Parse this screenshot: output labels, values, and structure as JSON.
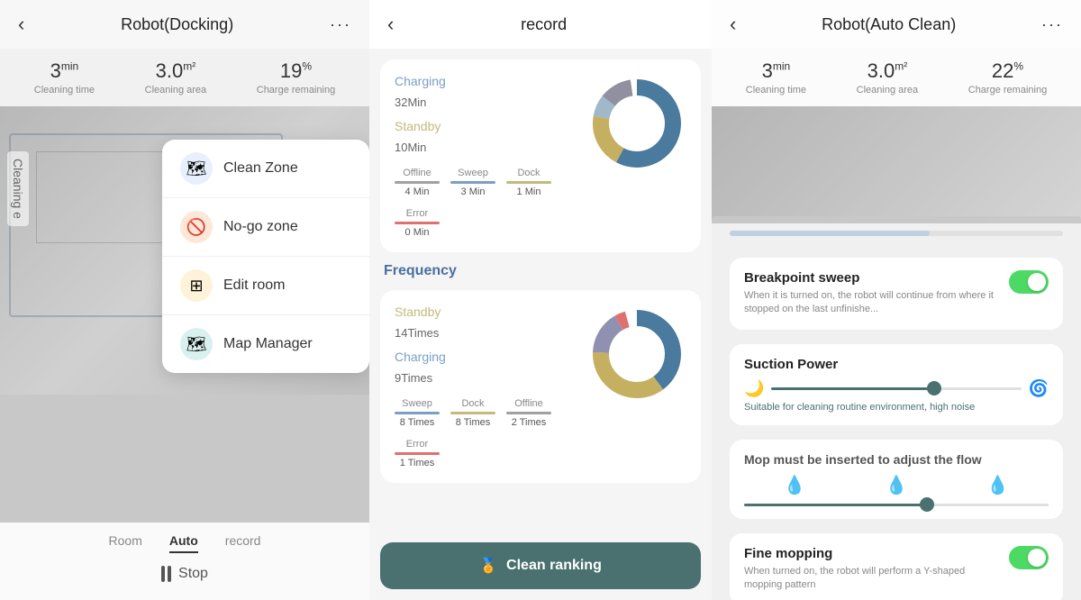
{
  "left": {
    "title": "Robot(Docking)",
    "stats": [
      {
        "value": "3",
        "unit": "min",
        "label": "Cleaning time"
      },
      {
        "value": "3.0",
        "unit": "m²",
        "label": "Cleaning area"
      },
      {
        "value": "19",
        "unit": "%",
        "label": "Charge remaining"
      }
    ],
    "cleaning_label": "Cleaning e",
    "menu": [
      {
        "icon": "🗺",
        "icon_class": "blue",
        "label": "Clean Zone"
      },
      {
        "icon": "🚫",
        "icon_class": "orange",
        "label": "No-go zone"
      },
      {
        "icon": "⊞",
        "icon_class": "yellow",
        "label": "Edit room"
      },
      {
        "icon": "🗺",
        "icon_class": "teal",
        "label": "Map Manager"
      }
    ],
    "nav_tabs": [
      "Room",
      "Auto",
      "record"
    ],
    "active_tab": "Auto",
    "stop_label": "Stop"
  },
  "center": {
    "title": "record",
    "usage_card": {
      "charging_label": "Charging",
      "charging_value": "32",
      "charging_unit": "Min",
      "standby_label": "Standby",
      "standby_value": "10",
      "standby_unit": "Min",
      "mini_stats": [
        {
          "label": "Offline",
          "value": "4 Min",
          "bar_class": "offline-bar"
        },
        {
          "label": "Sweep",
          "value": "3 Min",
          "bar_class": "sweep-bar"
        },
        {
          "label": "Dock",
          "value": "1 Min",
          "bar_class": "dock-bar"
        },
        {
          "label": "Error",
          "value": "0 Min",
          "bar_class": "error-bar"
        }
      ]
    },
    "frequency_title": "Frequency",
    "frequency_card": {
      "standby_label": "Standby",
      "standby_value": "14",
      "standby_unit": "Times",
      "charging_label": "Charging",
      "charging_value": "9",
      "charging_unit": "Times",
      "mini_stats": [
        {
          "label": "Sweep",
          "value": "8 Times",
          "bar_class": "sweep-bar"
        },
        {
          "label": "Dock",
          "value": "8 Times",
          "bar_class": "dock-bar"
        },
        {
          "label": "Offline",
          "value": "2 Times",
          "bar_class": "offline-bar"
        },
        {
          "label": "Error",
          "value": "1 Times",
          "bar_class": "error-bar"
        }
      ]
    },
    "ranking_btn": "Clean ranking",
    "ranking_icon": "🏅"
  },
  "right": {
    "title": "Robot(Auto Clean)",
    "stats": [
      {
        "value": "3",
        "unit": "min",
        "label": "Cleaning time"
      },
      {
        "value": "3.0",
        "unit": "m²",
        "label": "Cleaning area"
      },
      {
        "value": "22",
        "unit": "%",
        "label": "Charge remaining"
      }
    ],
    "settings": [
      {
        "id": "breakpoint",
        "title": "Breakpoint sweep",
        "desc": "When it is turned on, the robot will continue from where it stopped on the last unfinishe...",
        "toggle": true,
        "enabled": true
      }
    ],
    "suction_title": "Suction Power",
    "suction_desc": "Suitable for cleaning routine environment, high noise",
    "suction_level": 65,
    "mop_title": "Mop must be inserted to adjust the flow",
    "mop_level": 60,
    "fine_mopping_title": "Fine mopping",
    "fine_mopping_desc": "When turned on, the robot will perform a Y-shaped mopping pattern",
    "fine_mopping_enabled": true
  },
  "icons": {
    "back": "‹",
    "more": "···",
    "medal": "🏅",
    "moon": "🌙",
    "fan": "🌀",
    "water_low": "💧",
    "water_mid": "💧",
    "water_high": "💧"
  }
}
